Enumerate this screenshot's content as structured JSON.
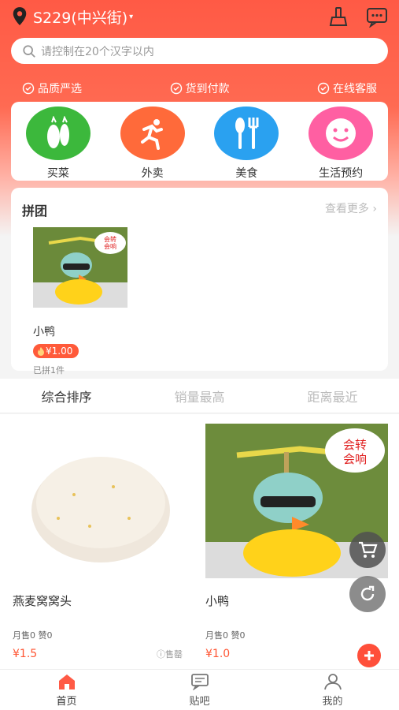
{
  "header": {
    "location": "S229(中兴街)",
    "caret": "▾"
  },
  "search": {
    "placeholder": "请控制在20个汉字以内"
  },
  "badges": [
    "品质严选",
    "货到付款",
    "在线客服"
  ],
  "categories": [
    {
      "label": "买菜",
      "color": "#3cb83c",
      "icon": "vegetables-icon"
    },
    {
      "label": "外卖",
      "color": "#ff6a3a",
      "icon": "runner-icon"
    },
    {
      "label": "美食",
      "color": "#2aa1f0",
      "icon": "utensils-icon"
    },
    {
      "label": "生活预约",
      "color": "#ff5fa2",
      "icon": "smiley-icon"
    }
  ],
  "group_buy": {
    "title": "拼团",
    "more": "查看更多 ›",
    "item": {
      "name": "小鸭",
      "price": "¥1.00",
      "sold": "已拼1件",
      "bubble": "会转\n会响"
    }
  },
  "sort_tabs": [
    "综合排序",
    "销量最高",
    "距离最近"
  ],
  "products": [
    {
      "name": "燕麦窝窝头",
      "stats": "月售0  赞0",
      "price": "¥1.5",
      "status": "ⓘ售罄"
    },
    {
      "name": "小鸭",
      "stats": "月售0  赞0",
      "price": "¥1.0",
      "bubble": "会转\n会响"
    }
  ],
  "tabbar": [
    "首页",
    "贴吧",
    "我的"
  ],
  "colors": {
    "brand": "#ff5a45",
    "price": "#ff5533"
  }
}
